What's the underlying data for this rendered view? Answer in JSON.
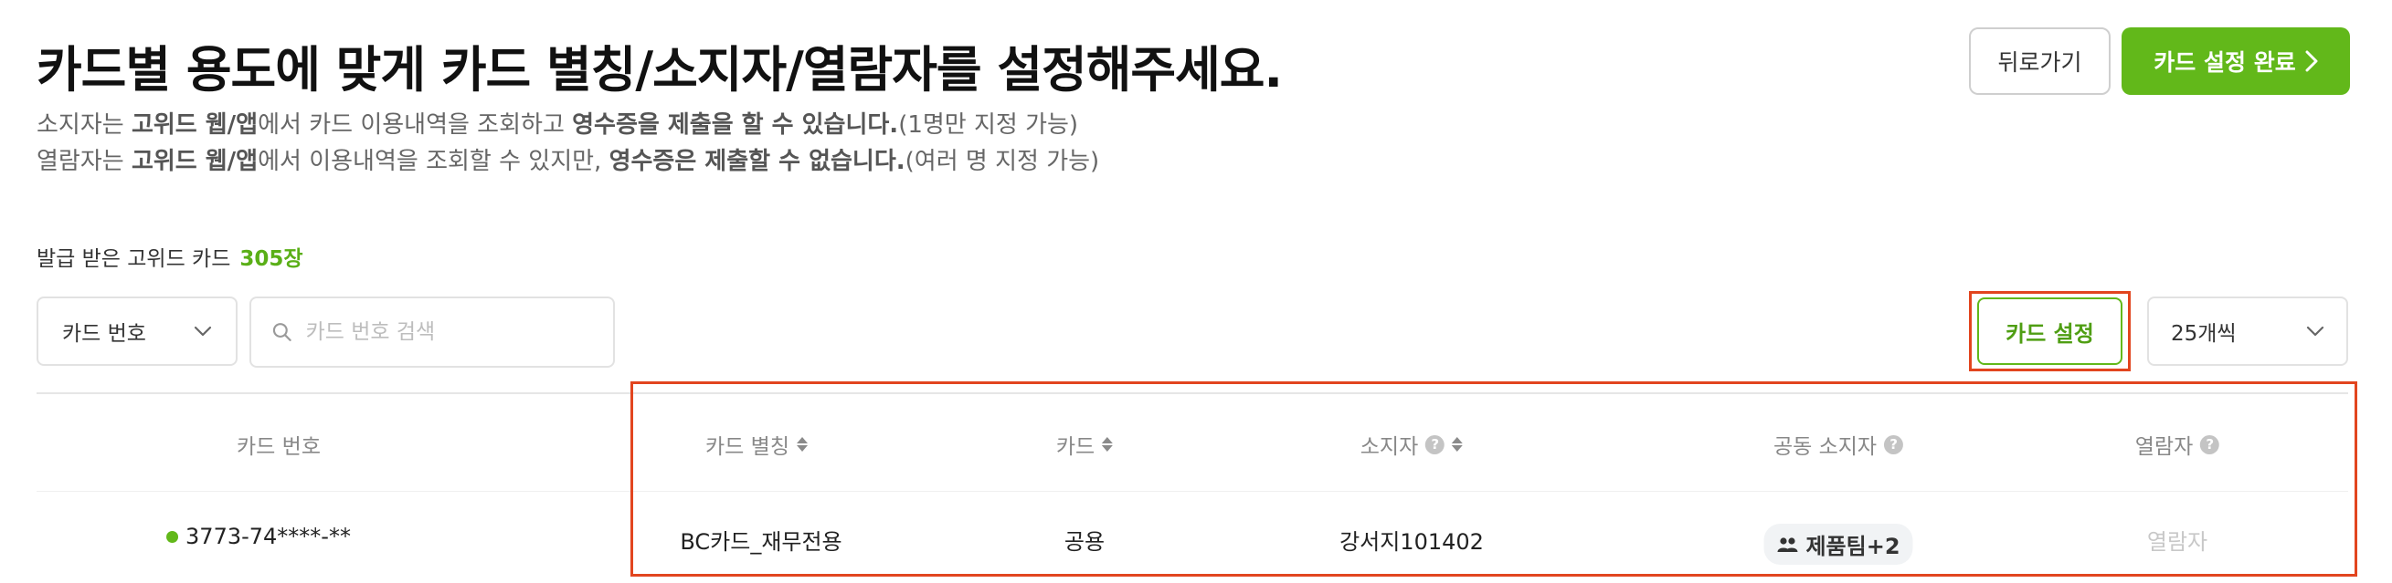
{
  "header": {
    "title": "카드별 용도에 맞게 카드 별칭/소지자/열람자를 설정해주세요.",
    "desc1": {
      "p1": "소지자는 ",
      "b1": "고위드 웹/앱",
      "p2": "에서 카드 이용내역을 조회하고 ",
      "b2": "영수증을 제출을 할 수 있습니다.",
      "p3": "(1명만 지정 가능)"
    },
    "desc2": {
      "p1": "열람자는 ",
      "b1": "고위드 웹/앱",
      "p2": "에서 이용내역을 조회할 수 있지만, ",
      "b2": "영수증은 제출할 수 없습니다.",
      "p3": "(여러 명 지정 가능)"
    },
    "back_label": "뒤로가기",
    "done_label": "카드 설정 완료"
  },
  "issued": {
    "label": "발급 받은 고위드 카드",
    "count": "305장"
  },
  "filters": {
    "card_select": "카드 번호",
    "search_placeholder": "카드 번호 검색",
    "card_setting_label": "카드 설정",
    "per_page": "25개씩"
  },
  "table": {
    "columns": {
      "card_number": "카드 번호",
      "alias": "카드 별칭",
      "card": "카드",
      "holder": "소지자",
      "co_holder": "공동 소지자",
      "viewer": "열람자"
    },
    "row": {
      "card_number": "3773-74****-**",
      "alias": "BC카드_재무전용",
      "card": "공용",
      "holder": "강서지101402",
      "co_holder": "제품팀+2",
      "viewer": "열람자"
    }
  },
  "colors": {
    "accent": "#62b81a",
    "highlight": "#e2451f"
  }
}
